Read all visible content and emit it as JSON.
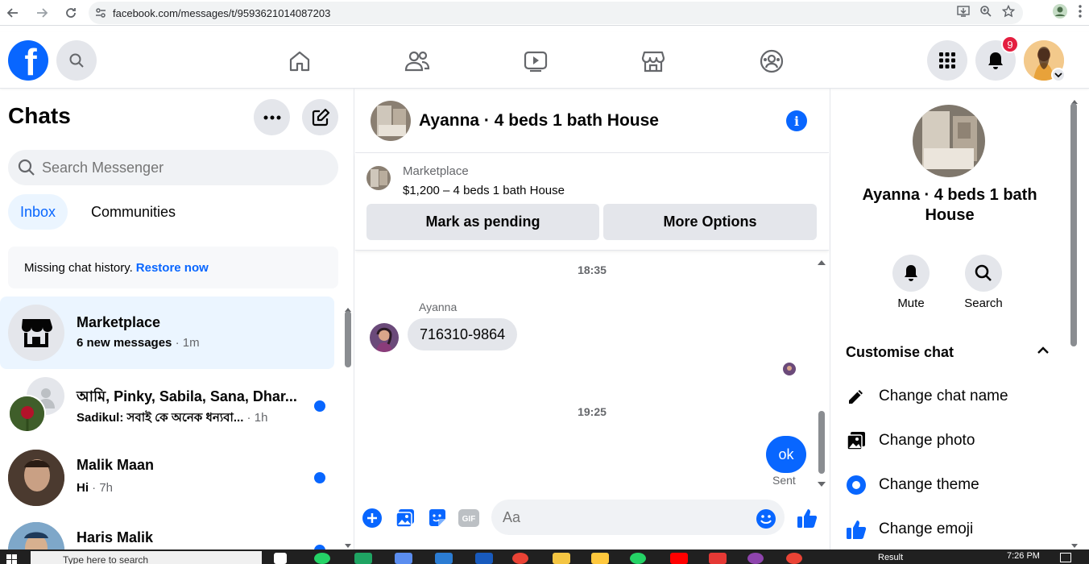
{
  "browser": {
    "url": "facebook.com/messages/t/9593621014087203"
  },
  "topnav": {
    "notification_count": "9"
  },
  "left": {
    "title": "Chats",
    "search_placeholder": "Search Messenger",
    "tabs": [
      {
        "label": "Inbox",
        "active": true
      },
      {
        "label": "Communities",
        "active": false
      }
    ],
    "missing_text": "Missing chat history.",
    "restore_link": "Restore now",
    "chats": [
      {
        "name": "Marketplace",
        "preview": "6 new messages",
        "time": " · 1m",
        "unread": false,
        "active": true
      },
      {
        "name": "আমি, Pinky, Sabila, Sana, Dhar...",
        "preview": "Sadikul: সবাই কে অনেক ধন্যবা...",
        "time": " · 1h",
        "unread": true,
        "active": false
      },
      {
        "name": "Malik Maan",
        "preview": "Hi",
        "time": " · 7h",
        "unread": true,
        "active": false
      },
      {
        "name": "Haris Malik",
        "preview": "",
        "time": "",
        "unread": true,
        "active": false
      }
    ]
  },
  "conversation": {
    "title": "Ayanna · 4 beds 1 bath House",
    "marketplace_label": "Marketplace",
    "listing": "$1,200 – 4 beds 1 bath House",
    "btn_pending": "Mark as pending",
    "btn_more": "More Options",
    "time1": "18:35",
    "sender": "Ayanna",
    "incoming_message": "716310-9864",
    "time2": "19:25",
    "outgoing_message": "ok",
    "sent_status": "Sent",
    "composer_placeholder": "Aa"
  },
  "right": {
    "name": "Ayanna · 4 beds 1 bath House",
    "mute_label": "Mute",
    "search_label": "Search",
    "customise_title": "Customise chat",
    "items": [
      {
        "label": "Change chat name",
        "icon": "pencil-icon"
      },
      {
        "label": "Change photo",
        "icon": "photo-icon"
      },
      {
        "label": "Change theme",
        "icon": "theme-icon"
      },
      {
        "label": "Change emoji",
        "icon": "thumbs-up-icon"
      }
    ]
  },
  "taskbar": {
    "search_placeholder": "Type here to search",
    "time": "7:26 PM",
    "result_text": "Result"
  },
  "colors": {
    "accent": "#0866ff",
    "badge": "#e41e3f",
    "active_bg": "#ebf5ff"
  }
}
